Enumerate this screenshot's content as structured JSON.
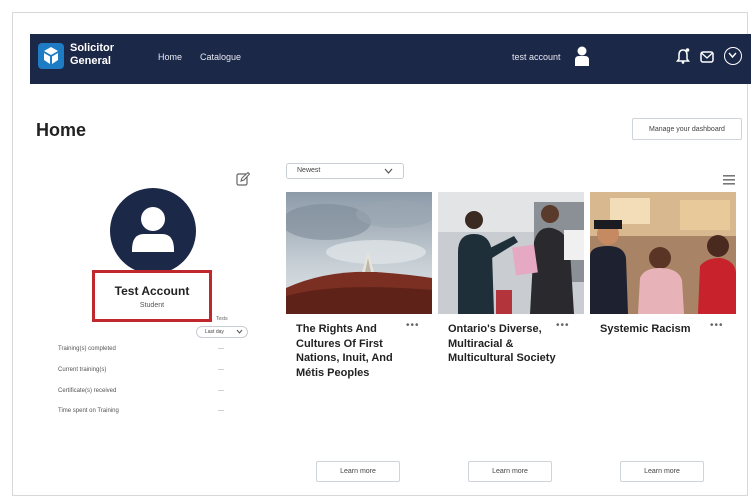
{
  "header": {
    "brand_line1": "Solicitor",
    "brand_line2": "General",
    "nav": [
      {
        "label": "Home"
      },
      {
        "label": "Catalogue"
      }
    ],
    "account_label": "test account",
    "colors": {
      "bar": "#1c2848",
      "logo": "#1d7cc4"
    }
  },
  "page": {
    "title": "Home",
    "manage_button": "Manage your dashboard"
  },
  "profile": {
    "name": "Test Account",
    "role": "Student",
    "tests_label": "Tests",
    "period": "Last day",
    "stats": [
      {
        "label": "Training(s) completed",
        "value": "---"
      },
      {
        "label": "Current training(s)",
        "value": "---"
      },
      {
        "label": "Certificate(s) received",
        "value": "---"
      },
      {
        "label": "Time spent on Training",
        "value": "---"
      }
    ],
    "highlight_color": "#c0282e"
  },
  "catalog": {
    "sort_value": "Newest",
    "cards": [
      {
        "title": "The Rights And Cultures Of First Nations, Inuit, And Métis Peoples",
        "button": "Learn more"
      },
      {
        "title": "Ontario's Diverse, Multiracial & Multicultural Society",
        "button": "Learn more"
      },
      {
        "title": "Systemic Racism",
        "button": "Learn more"
      }
    ]
  }
}
